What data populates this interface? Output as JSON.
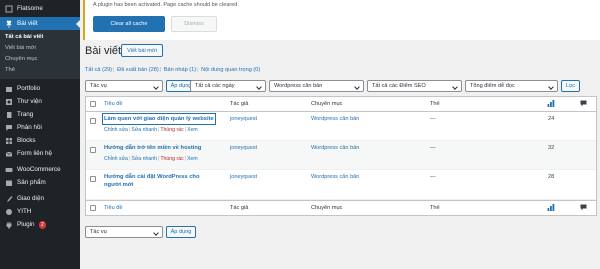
{
  "sidebar": {
    "top_item": "Flatsome",
    "active_item": "Bài viết",
    "submenu": [
      "Tất cả bài viết",
      "Viết bài mới",
      "Chuyên mục",
      "Thẻ"
    ],
    "items": [
      "Portfolio",
      "Thư viện",
      "Trang",
      "Phản hồi",
      "Blocks",
      "Form liên hệ",
      "WooCommerce",
      "Sản phẩm",
      "Giao diện",
      "YITH",
      "Plugin"
    ],
    "plugin_badge": "2"
  },
  "notice": {
    "message": "A plugin has been activated. Page cache should be cleared.",
    "clear_button": "Clear all cache",
    "dismiss_button": "Dismiss"
  },
  "page": {
    "title": "Bài viết",
    "add_new": "Viết bài mới"
  },
  "views": {
    "all": "Tất cả (29)",
    "published": "Đã xuất bản (28)",
    "draft": "Bản nháp (1)",
    "cornerstone": "Nội dung quan trọng (0)"
  },
  "filters": {
    "bulk_action": "Tác vụ",
    "apply": "Áp dụng",
    "dates": "Tất cả các ngày",
    "category": "Wordpress căn bản",
    "seo": "Tất cả các Điểm SEO",
    "readability": "Tổng điểm dễ đọc",
    "filter_button": "Lọc"
  },
  "table": {
    "headers": {
      "title": "Tiêu đề",
      "author": "Tác giả",
      "category": "Chuyên mục",
      "tags": "Thẻ"
    },
    "row_actions": {
      "edit": "Chỉnh sửa",
      "quick_edit": "Sửa nhanh",
      "trash": "Thùng rác",
      "view": "Xem"
    },
    "rows": [
      {
        "title": "Làm quen với giao diện quản lý website",
        "author": "joneyquest",
        "category": "Wordpress căn bản",
        "tags": "—",
        "count": "24"
      },
      {
        "title": "Hướng dẫn trở tên miền về hosting",
        "author": "joneyquest",
        "category": "Wordpress căn bản",
        "tags": "—",
        "count": "32"
      },
      {
        "title": "Hướng dẫn cài đặt WordPress cho người mới",
        "author": "joneyquest",
        "category": "Wordpress căn bản",
        "tags": "—",
        "count": "28"
      }
    ]
  },
  "bottom_filters": {
    "bulk_action": "Tác vụ",
    "apply": "Áp dụng"
  },
  "colors": {
    "sidebar": "#1d2327",
    "accent": "#2271b1",
    "trash": "#b32d2e"
  }
}
